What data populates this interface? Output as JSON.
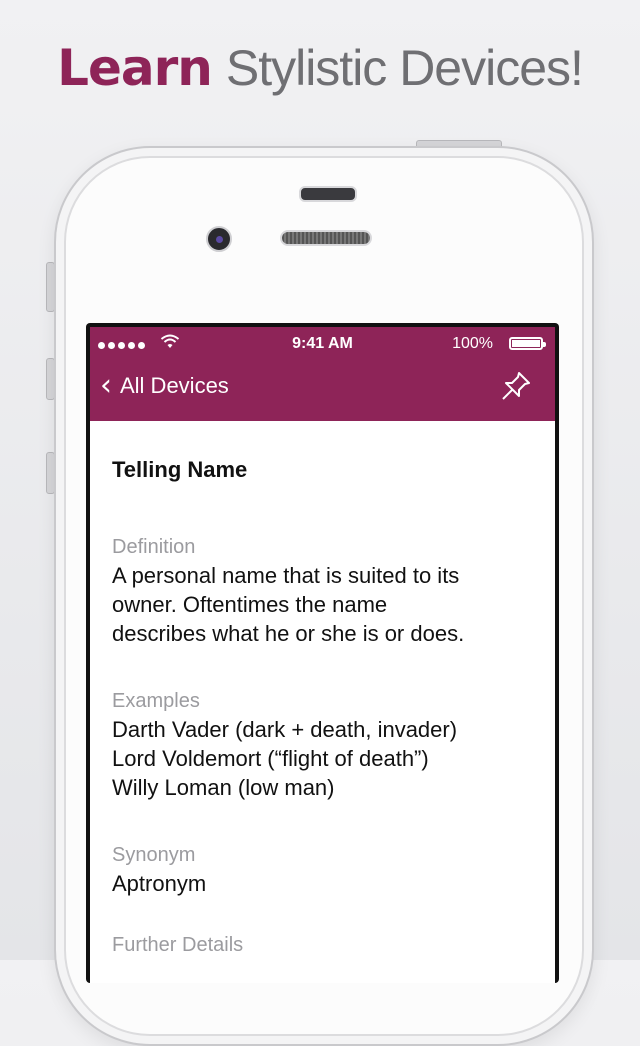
{
  "headline": {
    "bold": "Learn",
    "light": "Stylistic Devices!"
  },
  "status_bar": {
    "time": "9:41 AM",
    "battery": "100%"
  },
  "nav": {
    "back_label": "All Devices"
  },
  "device": {
    "name": "Telling Name",
    "definition_label": "Definition",
    "definition_lines": [
      "A personal name that is suited to its",
      "owner. Oftentimes the name",
      "describes what he or she is or does."
    ],
    "examples_label": "Examples",
    "examples": [
      "Darth Vader (dark + death, invader)",
      "Lord Voldemort (“flight of death”)",
      "Willy Loman (low man)"
    ],
    "synonym_label": "Synonym",
    "synonym": "Aptronym",
    "further_label": "Further Details"
  },
  "colors": {
    "accent": "#8e2458"
  },
  "icons": {
    "back": "chevron-left-icon",
    "pin": "pin-icon",
    "wifi": "wifi-icon",
    "battery": "battery-icon"
  }
}
